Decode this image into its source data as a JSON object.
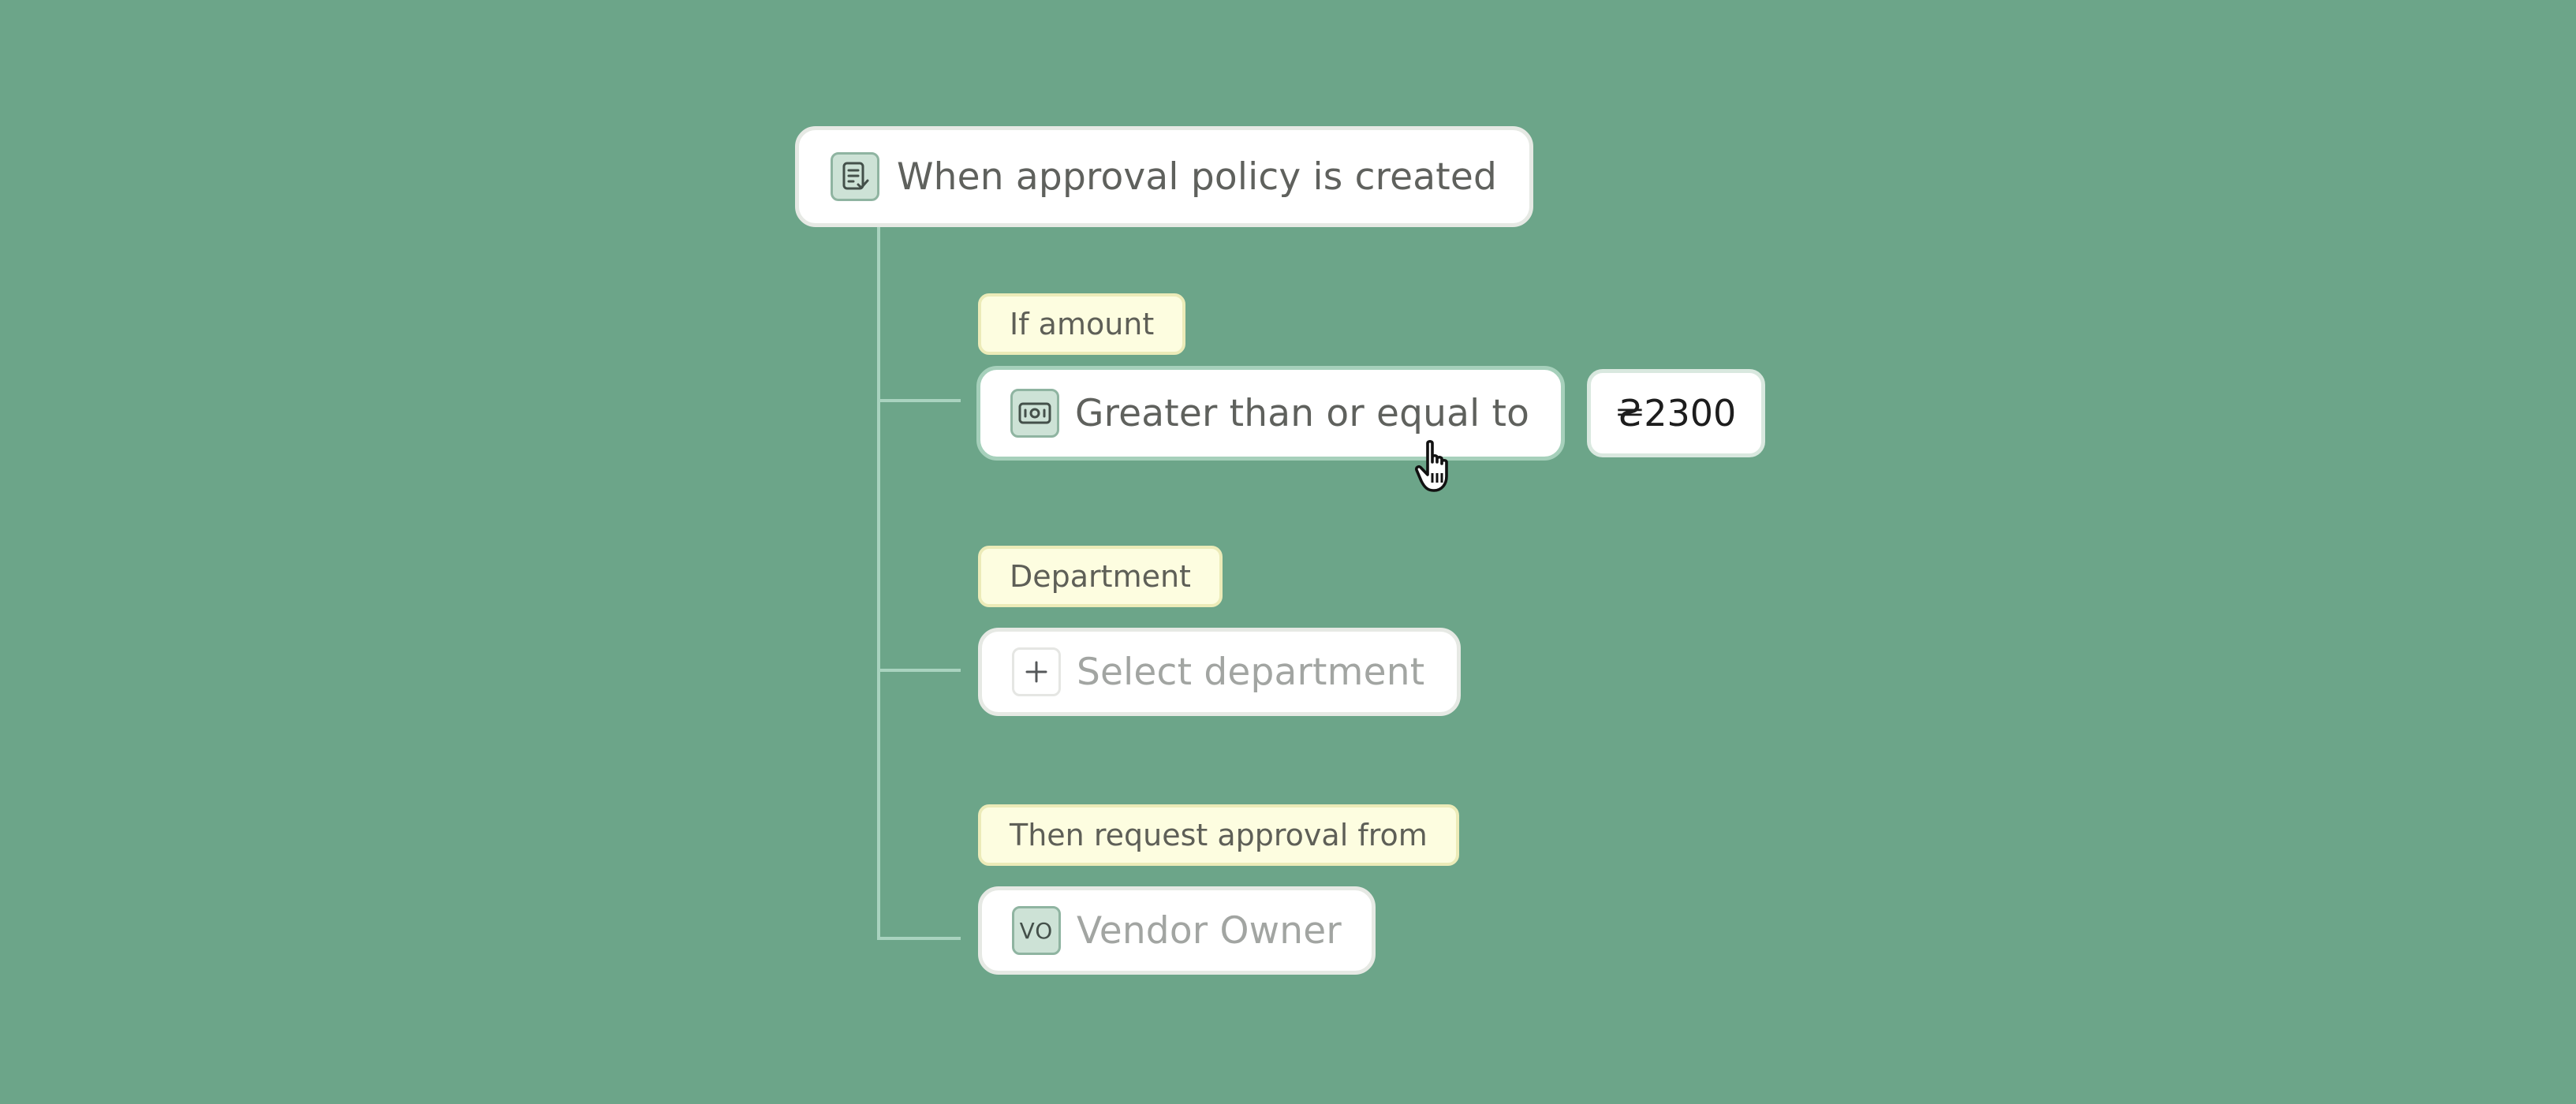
{
  "trigger": {
    "label": "When approval policy is created",
    "icon": "document-check-icon"
  },
  "amount_condition": {
    "tag": "If amount",
    "operator_label": "Greater than or equal to",
    "operator_icon": "cash-icon",
    "value": "₴2300"
  },
  "department": {
    "tag": "Department",
    "placeholder": "Select department",
    "icon": "plus-icon"
  },
  "approver": {
    "tag": "Then request approval from",
    "avatar_initials": "VO",
    "label": "Vendor Owner"
  },
  "colors": {
    "background": "#6ca589",
    "tag_background": "#fdfde0",
    "connector": "#a9d3bf",
    "icon_fill": "#cde2d6"
  }
}
